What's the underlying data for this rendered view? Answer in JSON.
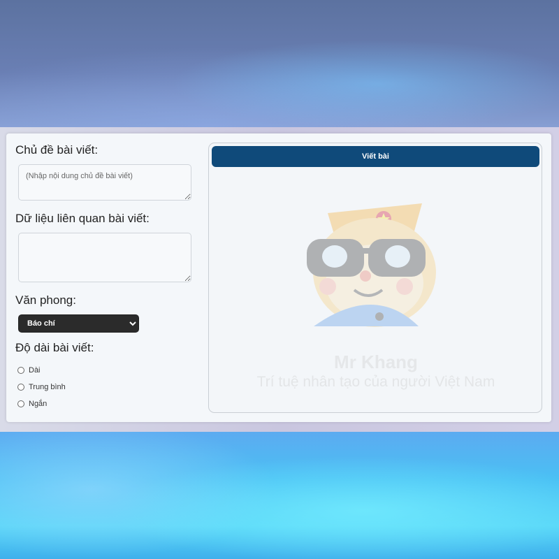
{
  "form": {
    "topic_label": "Chủ đề bài viết:",
    "topic_placeholder": "(Nhập nội dung chủ đề bài viết)",
    "topic_value": "",
    "related_label": "Dữ liệu liên quan bài viết:",
    "related_placeholder": "",
    "related_value": "",
    "style_label": "Văn phong:",
    "style_selected": "Báo chí",
    "length_label": "Độ dài bài viết:",
    "length_options": [
      {
        "label": "Dài",
        "checked": false
      },
      {
        "label": "Trung bình",
        "checked": false
      },
      {
        "label": "Ngắn",
        "checked": false
      }
    ]
  },
  "output": {
    "write_button_label": "Viết bài",
    "watermark_name": "Mr Khang",
    "watermark_tagline": "Trí tuệ nhân tạo của người Việt Nam",
    "watermark_icon": "mascot-with-sunglasses-and-star-cap"
  },
  "colors": {
    "button_bg": "#0f4a7a",
    "select_bg": "#2b2b2b",
    "card_bg": "#f4f7fa"
  }
}
